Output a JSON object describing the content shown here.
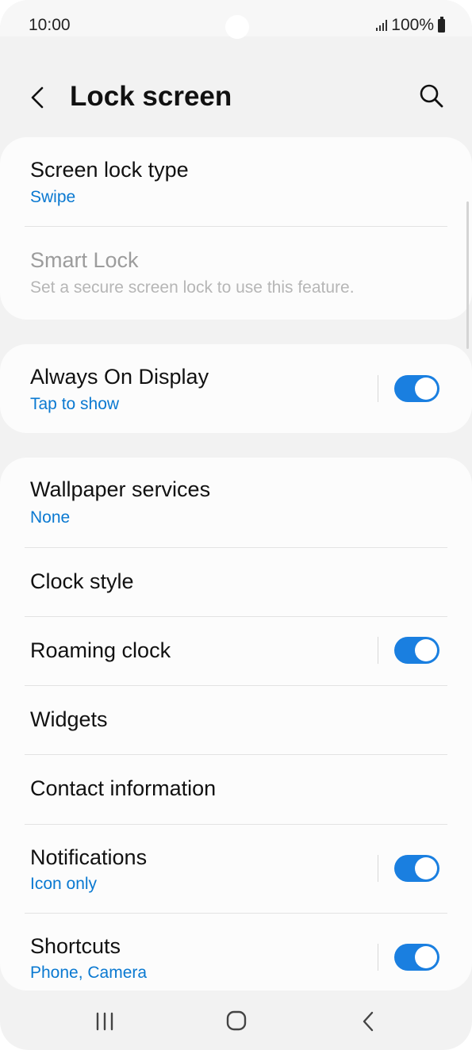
{
  "status_bar": {
    "time": "10:00",
    "battery": "100%"
  },
  "header": {
    "title": "Lock screen"
  },
  "sections": [
    {
      "items": [
        {
          "title": "Screen lock type",
          "subtitle": "Swipe"
        },
        {
          "title": "Smart Lock",
          "subtitle": "Set a secure screen lock to use this feature.",
          "disabled": true
        }
      ]
    },
    {
      "items": [
        {
          "title": "Always On Display",
          "subtitle": "Tap to show",
          "toggle": true
        }
      ]
    },
    {
      "items": [
        {
          "title": "Wallpaper services",
          "subtitle": "None"
        },
        {
          "title": "Clock style"
        },
        {
          "title": "Roaming clock",
          "toggle": true
        },
        {
          "title": "Widgets"
        },
        {
          "title": "Contact information"
        },
        {
          "title": "Notifications",
          "subtitle": "Icon only",
          "toggle": true
        },
        {
          "title": "Shortcuts",
          "subtitle": "Phone, Camera",
          "toggle": true
        }
      ]
    }
  ],
  "icons": {
    "back": "chevron-left-icon",
    "search": "search-icon",
    "nav_recents": "recents-icon",
    "nav_home": "home-icon",
    "nav_back": "back-icon"
  },
  "colors": {
    "accent": "#1a7fe0",
    "subtitle": "#0a79d1",
    "background": "#f2f2f2",
    "card": "#fcfcfc"
  }
}
